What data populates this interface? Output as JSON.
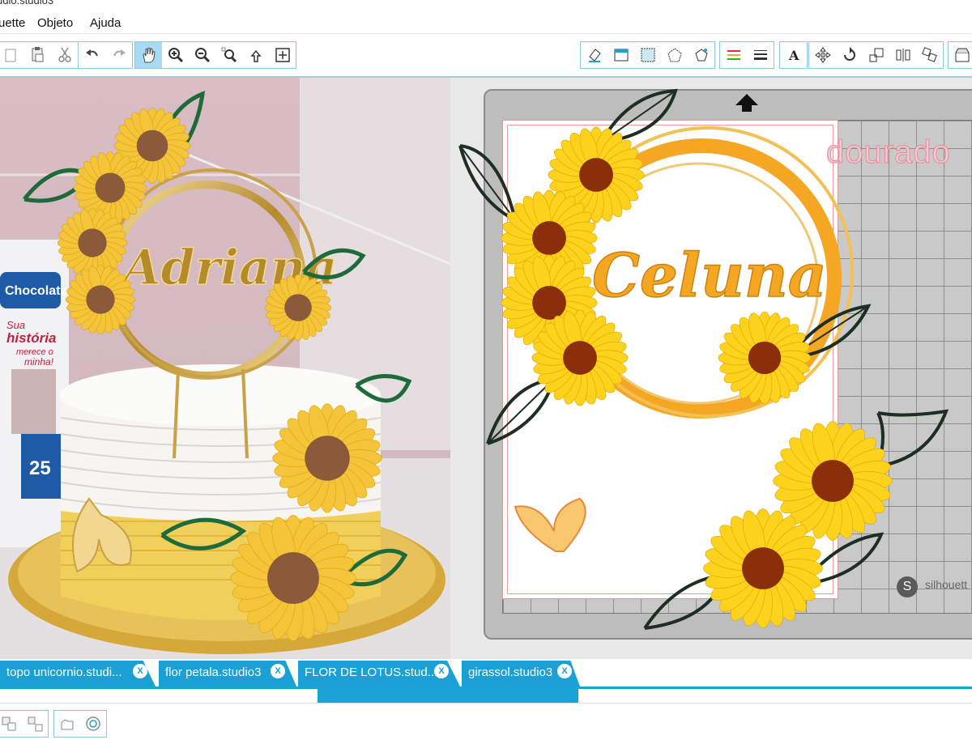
{
  "window": {
    "title": "udio.studio3"
  },
  "menu": [
    "uette",
    "Objeto",
    "Ajuda"
  ],
  "toolbar": {
    "left_icons": [
      "paste-icon",
      "paste-in-front-icon",
      "cut-icon",
      "undo-icon",
      "redo-icon",
      "pan-hand-icon",
      "zoom-in-icon",
      "zoom-out-icon",
      "zoom-select-icon",
      "zoom-drag-icon",
      "fit-to-page-icon"
    ],
    "right_icons": [
      "eraser-icon",
      "page-setup-icon",
      "fill-pattern-icon",
      "line-style-icon",
      "offset-icon",
      "line-color-icon",
      "line-width-icon",
      "text-icon",
      "move-icon",
      "rotate-icon",
      "scale-icon",
      "align-icon",
      "replicate-icon",
      "store-icon"
    ]
  },
  "canvas": {
    "name_text": "Celuna",
    "watermark_text": "dourado",
    "brand": "silhouett"
  },
  "photo": {
    "topper_text": "Adriana",
    "package_brand": "Chocolate",
    "package_line1": "Sua",
    "package_line2": "história",
    "package_line3": "merece o",
    "package_line4": "minha!",
    "package_number": "25"
  },
  "tabs": [
    {
      "label": "topo unicornio.studi..."
    },
    {
      "label": "flor petala.studio3"
    },
    {
      "label": "FLOR DE LOTUS.stud..."
    },
    {
      "label": "girassol.studio3"
    }
  ],
  "bottom_icons": [
    "group-icon",
    "ungroup-icon",
    "make-compound-icon",
    "release-compound-icon"
  ],
  "colors": {
    "accent": "#1ba3d6",
    "sunflower": "#f7c51d",
    "leaf": "#1d5a32",
    "ring": "#f5a623"
  }
}
